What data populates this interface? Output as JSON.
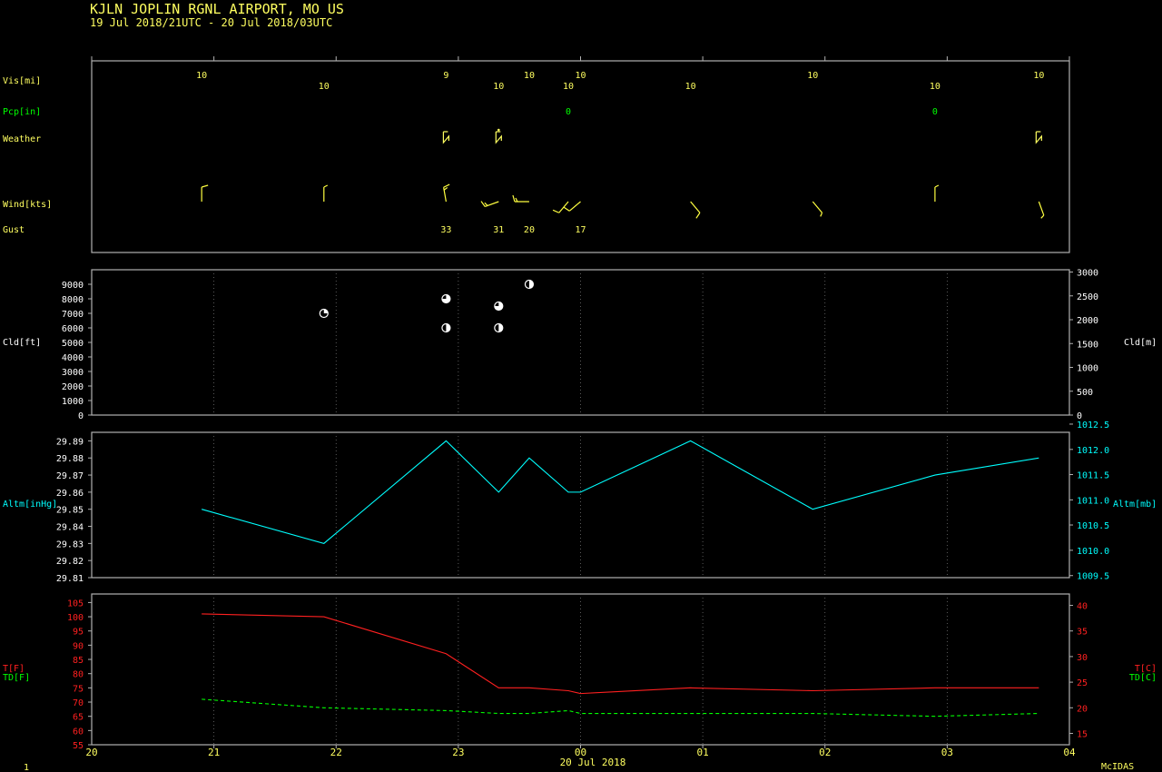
{
  "header": {
    "station_line": "KJLN  JOPLIN RGNL AIRPORT, MO US",
    "time_range": "19 Jul 2018/21UTC - 20 Jul 2018/03UTC"
  },
  "footer": {
    "frame_number": "1",
    "date_label": "20 Jul 2018",
    "software": "McIDAS"
  },
  "colors": {
    "text_default": "#ffff60",
    "green": "#00ff00",
    "cyan": "#00ffff",
    "red": "#ff2020",
    "frame": "#b0b0b0",
    "grid": "#707070",
    "white": "#ffffff",
    "wind": "#ffff40"
  },
  "chart_data": [
    {
      "type": "table",
      "panel": "observations",
      "row_labels": {
        "visibility": "Vis[mi]",
        "precip": "Pcp[in]",
        "weather": "Weather",
        "wind": "Wind[kts]",
        "gust": "Gust"
      },
      "x_unit": "hours after 20 UTC",
      "visibility": [
        {
          "x": 0.9,
          "value": "10"
        },
        {
          "x": 1.9,
          "value": "10"
        },
        {
          "x": 2.9,
          "value": "9"
        },
        {
          "x": 3.33,
          "value": "10"
        },
        {
          "x": 3.58,
          "value": "10"
        },
        {
          "x": 3.9,
          "value": "10"
        },
        {
          "x": 4.0,
          "value": "10"
        },
        {
          "x": 4.9,
          "value": "10"
        },
        {
          "x": 5.9,
          "value": "10"
        },
        {
          "x": 6.9,
          "value": "10"
        },
        {
          "x": 7.75,
          "value": "10"
        }
      ],
      "precip": [
        {
          "x": 3.9,
          "value": "0"
        },
        {
          "x": 6.9,
          "value": "0"
        }
      ],
      "weather": [
        {
          "x": 2.9,
          "symbol": "thunderstorm-icon"
        },
        {
          "x": 3.33,
          "symbol": "thunderstorm-rain-icon"
        },
        {
          "x": 7.75,
          "symbol": "thunderstorm-icon"
        }
      ],
      "wind_barbs": [
        {
          "x": 0.9,
          "dir_deg": 360,
          "speed_kt": 10
        },
        {
          "x": 1.9,
          "dir_deg": 360,
          "speed_kt": 5
        },
        {
          "x": 2.9,
          "dir_deg": 350,
          "speed_kt": 15
        },
        {
          "x": 3.33,
          "dir_deg": 250,
          "speed_kt": 15
        },
        {
          "x": 3.58,
          "dir_deg": 270,
          "speed_kt": 15
        },
        {
          "x": 3.9,
          "dir_deg": 220,
          "speed_kt": 10
        },
        {
          "x": 4.0,
          "dir_deg": 230,
          "speed_kt": 10
        },
        {
          "x": 4.9,
          "dir_deg": 140,
          "speed_kt": 10
        },
        {
          "x": 5.9,
          "dir_deg": 140,
          "speed_kt": 5
        },
        {
          "x": 6.9,
          "dir_deg": 360,
          "speed_kt": 5
        },
        {
          "x": 7.75,
          "dir_deg": 160,
          "speed_kt": 5
        }
      ],
      "gust": [
        {
          "x": 2.9,
          "value": "33"
        },
        {
          "x": 3.33,
          "value": "31"
        },
        {
          "x": 3.58,
          "value": "20"
        },
        {
          "x": 4.0,
          "value": "17"
        }
      ]
    },
    {
      "type": "scatter",
      "panel": "cloud",
      "ylabel_left": "Cld[ft]",
      "ylabel_right": "Cld[m]",
      "ylim": [
        0,
        10000
      ],
      "yticks_left": [
        "0",
        "1000",
        "2000",
        "3000",
        "4000",
        "5000",
        "6000",
        "7000",
        "8000",
        "9000"
      ],
      "yticks_right": [
        "0",
        "500",
        "1000",
        "1500",
        "2000",
        "2500",
        "3000"
      ],
      "ylim_right_m": [
        0,
        3048
      ],
      "cover_units": "fraction of sky covered",
      "points": [
        {
          "x": 1.9,
          "y": 7000,
          "cover": 0.25
        },
        {
          "x": 2.9,
          "y": 8000,
          "cover": 0.75
        },
        {
          "x": 2.9,
          "y": 6000,
          "cover": 0.5
        },
        {
          "x": 3.33,
          "y": 7500,
          "cover": 0.75
        },
        {
          "x": 3.33,
          "y": 6000,
          "cover": 0.5
        },
        {
          "x": 3.58,
          "y": 9000,
          "cover": 0.5
        }
      ]
    },
    {
      "type": "line",
      "panel": "altimeter",
      "ylabel_left": "Altm[inHg]",
      "ylabel_right": "Altm[mb]",
      "ylim": [
        29.81,
        29.895
      ],
      "yticks_left": [
        "29.81",
        "29.82",
        "29.83",
        "29.84",
        "29.85",
        "29.86",
        "29.87",
        "29.88",
        "29.89"
      ],
      "yticks_right": [
        "1009.5",
        "1010.0",
        "1010.5",
        "1011.0",
        "1011.5",
        "1012.0",
        "1012.5"
      ],
      "yticks_right_inhg": [
        29.8112,
        29.826,
        29.8408,
        29.8555,
        29.8703,
        29.885,
        29.8998
      ],
      "x": [
        0.9,
        1.9,
        2.9,
        3.33,
        3.58,
        3.9,
        4.0,
        4.9,
        5.9,
        6.9,
        7.75
      ],
      "values": [
        29.85,
        29.83,
        29.89,
        29.86,
        29.88,
        29.86,
        29.86,
        29.89,
        29.85,
        29.87,
        29.88
      ]
    },
    {
      "type": "line",
      "panel": "temperature",
      "ylabel_left_t": "T[F]",
      "ylabel_left_td": "TD[F]",
      "ylabel_right_t": "T[C]",
      "ylabel_right_td": "TD[C]",
      "ylim": [
        55,
        108
      ],
      "yticks_left": [
        "55",
        "60",
        "65",
        "70",
        "75",
        "80",
        "85",
        "90",
        "95",
        "100",
        "105"
      ],
      "yticks_right": [
        "15",
        "20",
        "25",
        "30",
        "35",
        "40"
      ],
      "yticks_right_f": [
        59,
        68,
        77,
        86,
        95,
        104
      ],
      "xlim": [
        0,
        8
      ],
      "xticks": [
        "20",
        "21",
        "22",
        "23",
        "00",
        "01",
        "02",
        "03",
        "04"
      ],
      "series": [
        {
          "name": "T",
          "x": [
            0.9,
            1.9,
            2.9,
            3.33,
            3.58,
            3.9,
            4.0,
            4.9,
            5.9,
            6.9,
            7.75
          ],
          "values": [
            101,
            100,
            87,
            75,
            75,
            74,
            73,
            75,
            74,
            75,
            75
          ]
        },
        {
          "name": "TD",
          "x": [
            0.9,
            1.9,
            2.9,
            3.33,
            3.58,
            3.9,
            4.0,
            4.9,
            5.9,
            6.9,
            7.75
          ],
          "values": [
            71,
            68,
            67,
            66,
            66,
            67,
            66,
            66,
            66,
            65,
            66
          ]
        }
      ]
    }
  ]
}
